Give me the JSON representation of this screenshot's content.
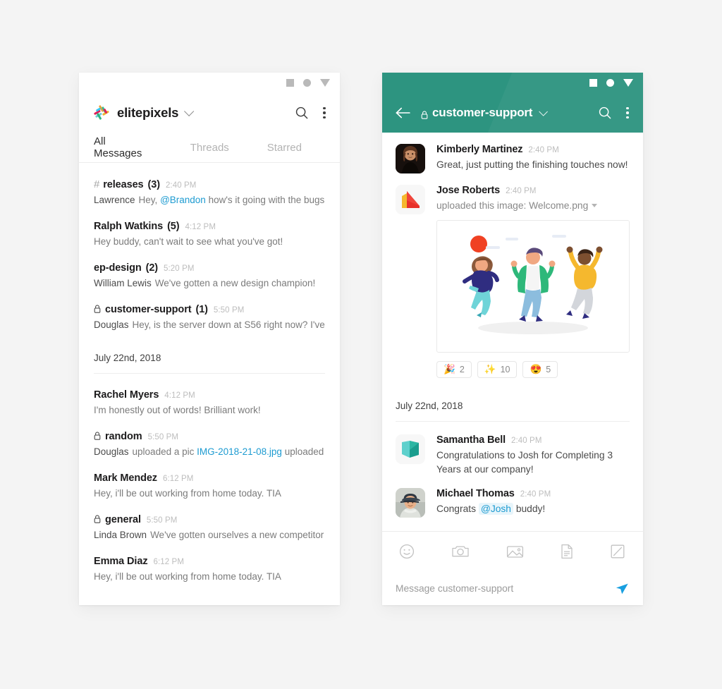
{
  "theme": {
    "page_bg": "#f4f4f4",
    "card_bg": "#ffffff",
    "accent_green": "#2d9480",
    "link_blue": "#1d9bd1",
    "send_blue": "#199fe0",
    "muted_text": "#b3b3b3"
  },
  "left_phone": {
    "nav_icons": [
      "square-icon",
      "circle-icon",
      "triangle-icon"
    ],
    "header": {
      "logo": "slack-logo",
      "workspace": "elitepixels",
      "dropdown_icon": "chevron-down-icon",
      "search_icon": "search-icon",
      "overflow_icon": "kebab-menu-icon"
    },
    "tabs": [
      {
        "label": "All Messages",
        "active": true
      },
      {
        "label": "Threads",
        "active": false
      },
      {
        "label": "Starred",
        "active": false
      }
    ],
    "conversations": [
      {
        "icon": "hash-icon",
        "name": "releases",
        "count": "(3)",
        "time": "2:40 PM",
        "author": "Lawrence",
        "preview_before": "Hey, ",
        "mention": "@Brandon",
        "preview_after": " how's it going with the bugs in"
      },
      {
        "icon": "none",
        "name": "Ralph Watkins",
        "count": "(5)",
        "time": "4:12 PM",
        "author": "",
        "preview_before": "Hey buddy, can't wait to see what you've got!",
        "mention": "",
        "preview_after": ""
      },
      {
        "icon": "none",
        "name": "ep-design",
        "count": "(2)",
        "time": "5:20 PM",
        "author": "William Lewis",
        "preview_before": "We've gotten a new design champion!",
        "mention": "",
        "preview_after": ""
      },
      {
        "icon": "lock-icon",
        "name": "customer-support",
        "count": "(1)",
        "time": "5:50 PM",
        "author": "Douglas",
        "preview_before": "Hey, is the server down at S56 right now? I've",
        "mention": "",
        "preview_after": ""
      }
    ],
    "date_divider": "July 22nd, 2018",
    "conversations_2": [
      {
        "icon": "none",
        "name": "Rachel Myers",
        "count": "",
        "time": "4:12 PM",
        "author": "",
        "preview_before": "I'm honestly out of words! Brilliant work!",
        "link": "",
        "preview_after": ""
      },
      {
        "icon": "lock-icon",
        "name": "random",
        "count": "",
        "time": "5:50 PM",
        "author": "Douglas",
        "preview_before": "uploaded a pic ",
        "link": "IMG-2018-21-08.jpg",
        "preview_after": " uploaded a pic"
      },
      {
        "icon": "none",
        "name": "Mark Mendez",
        "count": "",
        "time": "6:12 PM",
        "author": "",
        "preview_before": "Hey, i'll be out working from home today. TIA",
        "link": "",
        "preview_after": ""
      },
      {
        "icon": "lock-icon",
        "name": "general",
        "count": "",
        "time": "5:50 PM",
        "author": "Linda Brown",
        "preview_before": "We've gotten ourselves a new competitor",
        "link": "",
        "preview_after": ""
      },
      {
        "icon": "none",
        "name": "Emma Diaz",
        "count": "",
        "time": "6:12 PM",
        "author": "",
        "preview_before": "Hey, i'll be out working from home today. TIA",
        "link": "",
        "preview_after": ""
      }
    ]
  },
  "right_phone": {
    "nav_icons": [
      "square-icon",
      "circle-icon",
      "triangle-icon"
    ],
    "header": {
      "back_icon": "back-arrow-icon",
      "lock_icon": "lock-icon",
      "channel": "customer-support",
      "dropdown_icon": "chevron-down-icon",
      "search_icon": "search-icon",
      "overflow_icon": "kebab-menu-icon"
    },
    "messages_top": [
      {
        "avatar": "photo-avatar-woman",
        "name": "Kimberly Martinez",
        "time": "2:40 PM",
        "text": "Great, just putting the finishing touches now!",
        "muted": false
      },
      {
        "avatar": "logo-avatar-red",
        "name": "Jose Roberts",
        "time": "2:40 PM",
        "text": "uploaded this image: Welcome.png",
        "muted": true,
        "has_attachment": true,
        "attachment_alt": "three-people-jumping-illustration"
      }
    ],
    "reactions": [
      {
        "emoji": "🎉",
        "name": "party-popper-emoji",
        "count": "2"
      },
      {
        "emoji": "✨",
        "name": "sparkles-emoji",
        "count": "10"
      },
      {
        "emoji": "😍",
        "name": "heart-eyes-emoji",
        "count": "5"
      }
    ],
    "date_divider": "July 22nd, 2018",
    "messages_bottom": [
      {
        "avatar": "logo-avatar-teal",
        "name": "Samantha Bell",
        "time": "2:40 PM",
        "text": "Congratulations to Josh for Completing 3 Years at our company!",
        "mention": "",
        "text_after": ""
      },
      {
        "avatar": "photo-avatar-man",
        "name": "Michael Thomas",
        "time": "2:40 PM",
        "text": "Congrats ",
        "mention": "@Josh",
        "text_after": " buddy!"
      }
    ],
    "composer": {
      "icons": [
        "emoji-smiley-icon",
        "camera-icon",
        "image-icon",
        "document-icon",
        "snippet-icon"
      ],
      "placeholder": "Message customer-support",
      "send_icon": "send-paper-plane-icon"
    }
  }
}
